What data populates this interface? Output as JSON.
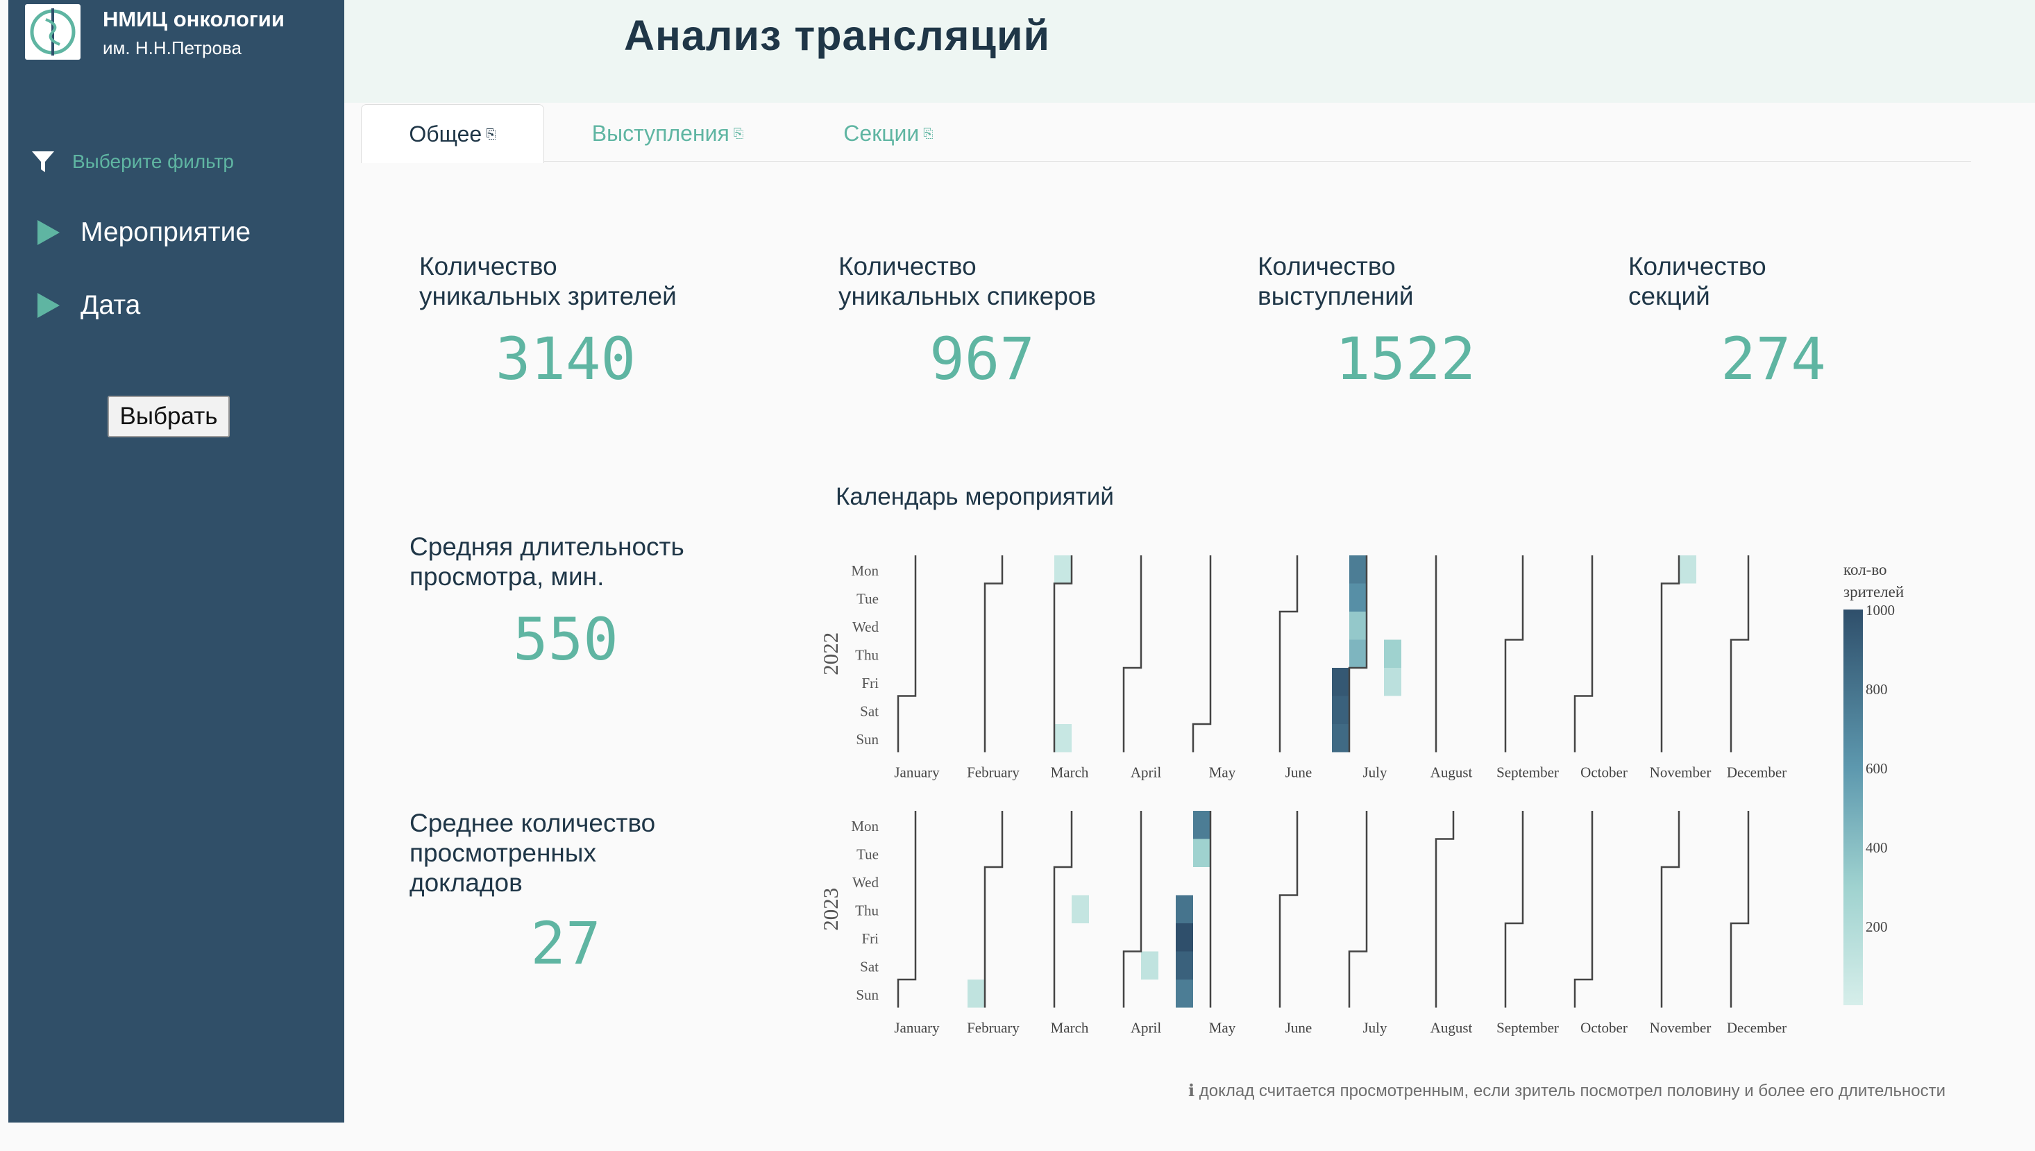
{
  "sidebar": {
    "org_name": "НМИЦ онкологии",
    "org_sub": "им. Н.Н.Петрова",
    "filter_label": "Выберите фильтр",
    "nav_items": [
      {
        "label": "Мероприятие"
      },
      {
        "label": "Дата"
      }
    ],
    "choose_button": "Выбрать"
  },
  "header": {
    "title": "Анализ трансляций"
  },
  "tabs": [
    {
      "label": "Общее",
      "active": true
    },
    {
      "label": "Выступления",
      "active": false
    },
    {
      "label": "Секции",
      "active": false
    }
  ],
  "kpis": [
    {
      "title": "Количество\nуникальных зрителей",
      "value": "3140"
    },
    {
      "title": "Количество\nуникальных спикеров",
      "value": "967"
    },
    {
      "title": "Количество\nвыступлений",
      "value": "1522"
    },
    {
      "title": "Количество\nсекций",
      "value": "274"
    },
    {
      "title": "Средняя длительность\nпросмотра, мин.",
      "value": "550"
    },
    {
      "title": "Среднее количество\nпросмотренных\nдокладов",
      "value": "27"
    }
  ],
  "calendar": {
    "title": "Календарь мероприятий",
    "footnote": "ℹ доклад считается просмотренным, если зритель посмотрел половину и более его длительности"
  },
  "colors": {
    "sidebar_bg": "#304f68",
    "accent": "#5fb5a2",
    "header_bg": "#eef6f3",
    "scale_low": "#d6eeea",
    "scale_high": "#2f4f6b"
  },
  "chart_data": {
    "type": "heatmap",
    "title": "Календарь мероприятий",
    "days": [
      "Mon",
      "Tue",
      "Wed",
      "Thu",
      "Fri",
      "Sat",
      "Sun"
    ],
    "months": [
      "January",
      "February",
      "March",
      "April",
      "May",
      "June",
      "July",
      "August",
      "September",
      "October",
      "November",
      "December"
    ],
    "colorbar": {
      "label": "кол-во зрителей",
      "min": 0,
      "max": 1000,
      "ticks": [
        200,
        400,
        600,
        800,
        1000
      ]
    },
    "years": [
      {
        "year": "2022",
        "cells": [
          {
            "week": 9,
            "day": 0,
            "value": 80
          },
          {
            "week": 9,
            "day": 6,
            "value": 80
          },
          {
            "week": 25,
            "day": 4,
            "value": 950
          },
          {
            "week": 25,
            "day": 5,
            "value": 900
          },
          {
            "week": 25,
            "day": 6,
            "value": 850
          },
          {
            "week": 26,
            "day": 0,
            "value": 750
          },
          {
            "week": 26,
            "day": 1,
            "value": 650
          },
          {
            "week": 26,
            "day": 2,
            "value": 350
          },
          {
            "week": 26,
            "day": 3,
            "value": 450
          },
          {
            "week": 28,
            "day": 3,
            "value": 300
          },
          {
            "week": 28,
            "day": 4,
            "value": 150
          },
          {
            "week": 45,
            "day": 0,
            "value": 100
          }
        ]
      },
      {
        "year": "2023",
        "cells": [
          {
            "week": 4,
            "day": 6,
            "value": 120
          },
          {
            "week": 10,
            "day": 3,
            "value": 100
          },
          {
            "week": 14,
            "day": 5,
            "value": 120
          },
          {
            "week": 16,
            "day": 3,
            "value": 800
          },
          {
            "week": 16,
            "day": 4,
            "value": 1000
          },
          {
            "week": 16,
            "day": 5,
            "value": 900
          },
          {
            "week": 16,
            "day": 6,
            "value": 750
          },
          {
            "week": 17,
            "day": 0,
            "value": 750
          },
          {
            "week": 17,
            "day": 1,
            "value": 300
          }
        ]
      }
    ]
  }
}
